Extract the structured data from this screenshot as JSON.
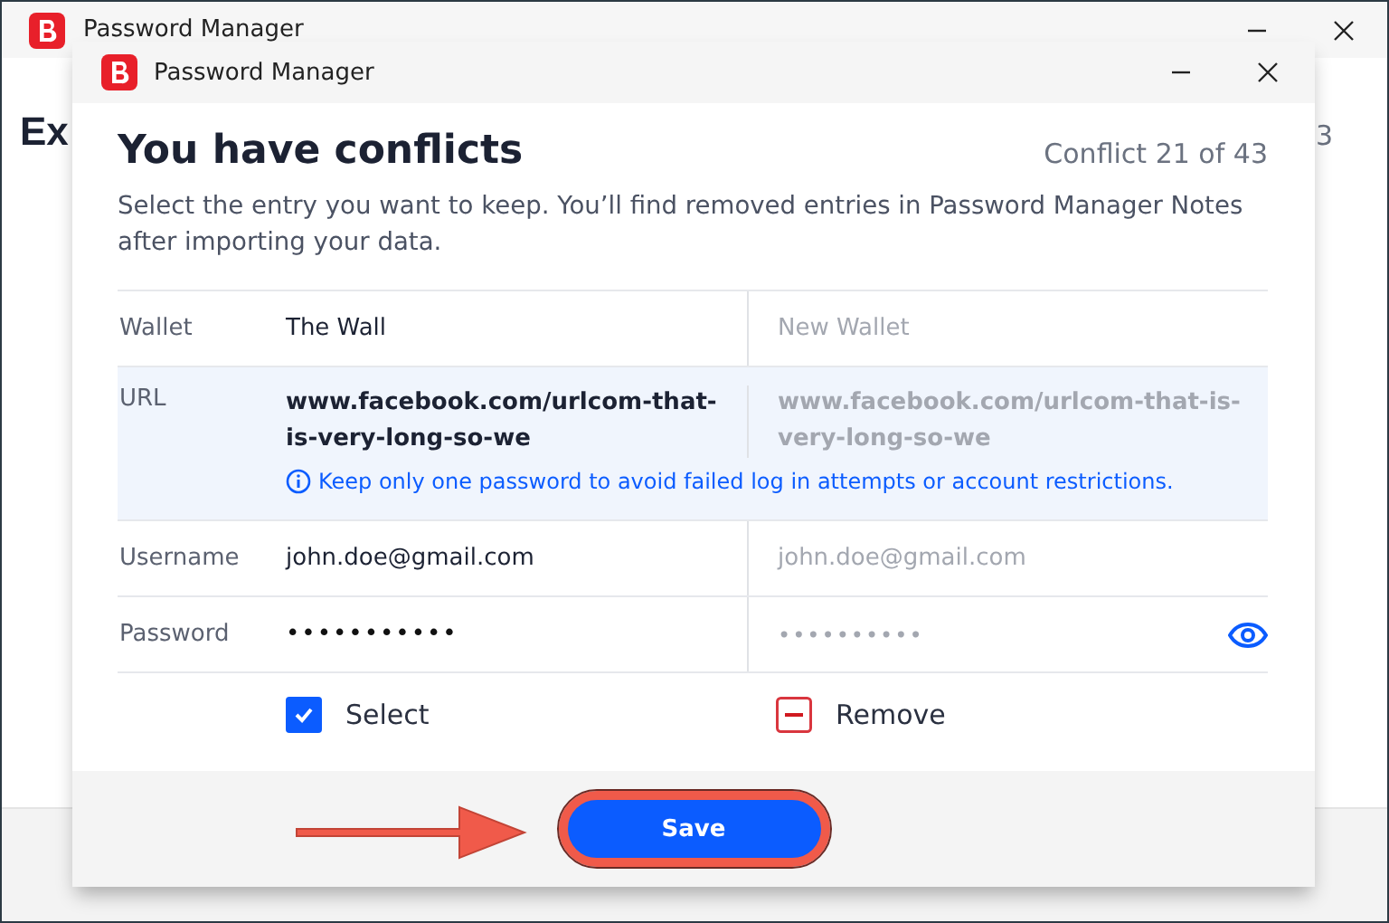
{
  "background_window": {
    "title": "Password Manager",
    "heading": "Ex",
    "counter": "3"
  },
  "dialog": {
    "title": "Password Manager",
    "heading": "You have conflicts",
    "counter": "Conflict 21 of 43",
    "description": "Select the entry you want to keep. You’ll find removed entries in Password Manager Notes after importing your data.",
    "rows": [
      {
        "kind": "text",
        "label": "Wallet",
        "kept": "The Wall",
        "other": "New Wallet"
      },
      {
        "kind": "url",
        "label": "URL",
        "kept": "www.facebook.com/urlcom-that-is-very-long-so-we",
        "other": "www.facebook.com/urlcom-that-is-very-long-so-we",
        "notice": "Keep only one password to avoid failed log in attempts or account restrictions."
      },
      {
        "kind": "text",
        "label": "Username",
        "kept": "john.doe@gmail.com",
        "other": "john.doe@gmail.com"
      },
      {
        "kind": "password",
        "label": "Password",
        "kept": "•••••••••••",
        "other": "••••••••••"
      }
    ],
    "choices": [
      {
        "label": "Select",
        "checked": true
      },
      {
        "label": "Remove",
        "checked": false
      }
    ],
    "save_button": "Save"
  }
}
